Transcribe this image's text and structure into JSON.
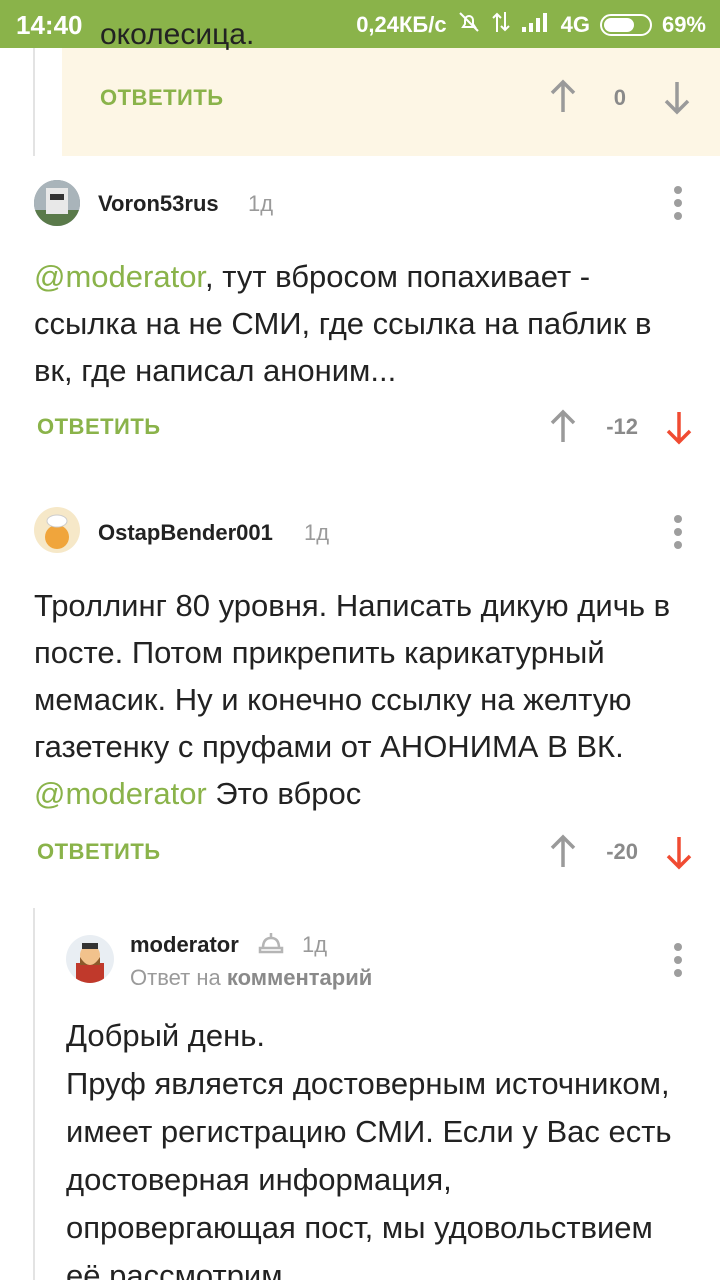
{
  "status_bar": {
    "time": "14:40",
    "speed": "0,24КБ/с",
    "network": "4G",
    "battery": "69%",
    "battery_level": 0.69
  },
  "previous_comment": {
    "cut_text": "околесица.",
    "reply_label": "ОТВЕТИТЬ",
    "score": "0"
  },
  "comments": [
    {
      "username": "Voron53rus",
      "time": "1д",
      "mention": "@moderator",
      "text_after_mention": ", тут вбросом попахивает - ссылка на не СМИ, где ссылка на паблик в вк, где написал аноним...",
      "reply_label": "ОТВЕТИТЬ",
      "score": "-12"
    },
    {
      "username": "OstapBender001",
      "time": "1д",
      "text_before_mention": "Троллинг 80 уровня. Написать дикую дичь в посте. Потом прикрепить карикатурный мемасик. Ну и конечно ссылку на желтую газетенку с пруфами от АНОНИМА В ВК.",
      "mention": "@moderator",
      "text_after_mention": " Это вброс",
      "reply_label": "ОТВЕТИТЬ",
      "score": "-20"
    },
    {
      "username": "moderator",
      "time": "1д",
      "reply_prefix": "Ответ на",
      "reply_target": "комментарий",
      "text": "Добрый день.\nПруф является достоверным источником, имеет регистрацию СМИ. Если у Вас есть достоверная информация, опровергающая пост, мы удовольствием её рассмотрим"
    }
  ],
  "colors": {
    "accent": "#8ab34a",
    "downvote_active": "#f04b32",
    "muted": "#9a9a9a",
    "highlight_bg": "#fdf6e5"
  }
}
